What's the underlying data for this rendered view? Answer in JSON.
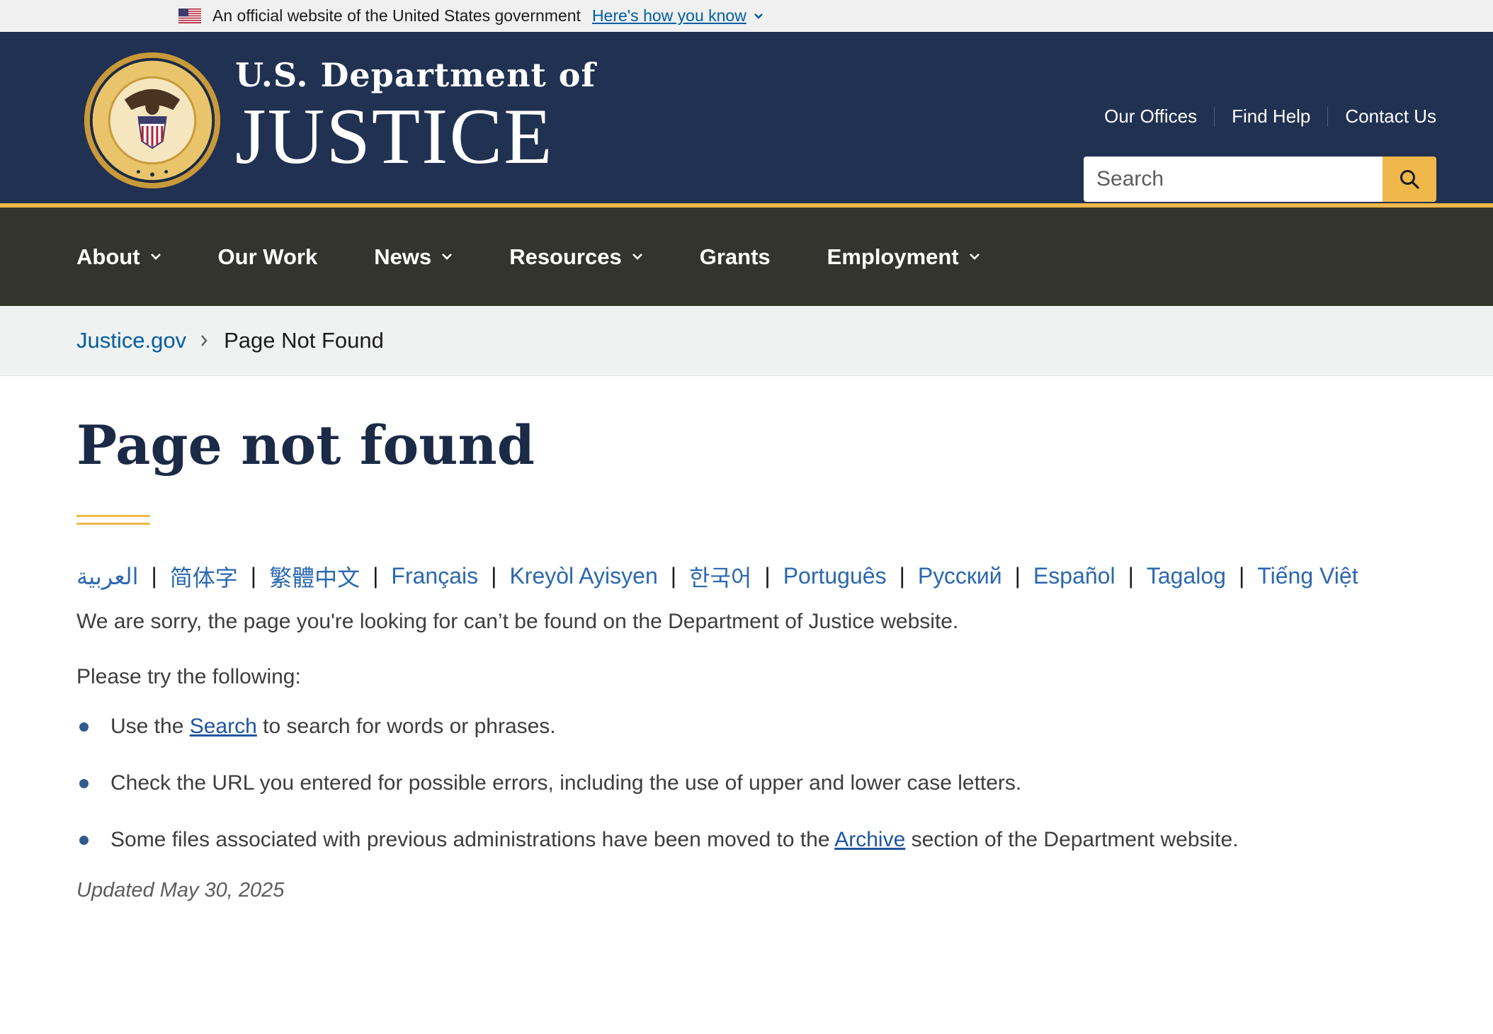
{
  "gov_banner": {
    "official_text": "An official website of the United States government",
    "how_link": "Here's how you know"
  },
  "header": {
    "brand_line1": "U.S. Department of",
    "brand_line2": "JUSTICE",
    "util_links": [
      "Our Offices",
      "Find Help",
      "Contact Us"
    ],
    "search_placeholder": "Search"
  },
  "nav": {
    "items": [
      {
        "label": "About",
        "has_dropdown": true
      },
      {
        "label": "Our Work",
        "has_dropdown": false
      },
      {
        "label": "News",
        "has_dropdown": true
      },
      {
        "label": "Resources",
        "has_dropdown": true
      },
      {
        "label": "Grants",
        "has_dropdown": false
      },
      {
        "label": "Employment",
        "has_dropdown": true
      }
    ]
  },
  "breadcrumb": {
    "home": "Justice.gov",
    "current": "Page Not Found"
  },
  "main": {
    "title": "Page not found",
    "languages": [
      "العربية",
      "简体字",
      "繁體中文",
      "Français",
      "Kreyòl Ayisyen",
      "한국어",
      "Português",
      "Русский",
      "Español",
      "Tagalog",
      "Tiếng Việt"
    ],
    "sorry_text": "We are sorry, the page you're looking for can’t be found on the Department of Justice website.",
    "try_text": "Please try the following:",
    "tip1_pre": "Use the ",
    "tip1_link": "Search",
    "tip1_post": " to search for words or phrases.",
    "tip2": "Check the URL you entered for possible errors, including the use of upper and lower case letters.",
    "tip3_pre": "Some files associated with previous administrations have been moved to the ",
    "tip3_link": "Archive",
    "tip3_post": " section of the Department website.",
    "updated": "Updated May 30, 2025"
  },
  "colors": {
    "header_bg": "#203152",
    "accent_gold": "#f0b84a",
    "nav_bg": "#34342f",
    "link_blue": "#005ea2"
  }
}
